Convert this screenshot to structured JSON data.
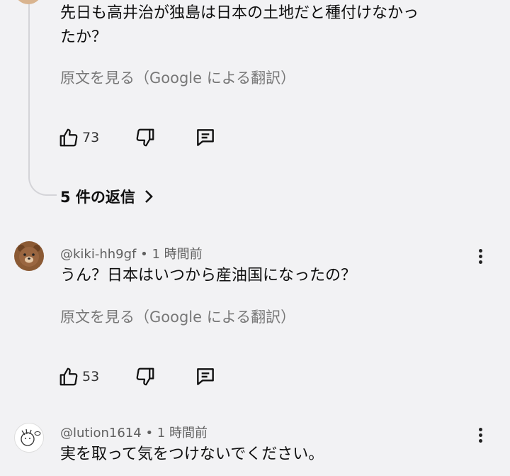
{
  "comments": [
    {
      "text_line1": "先日も高井治が独島は日本の土地だと種付けなかっ",
      "text_line2": "たか？",
      "translate_label": "原文を見る（Google による翻訳）",
      "likes": "73",
      "replies_label": "5 件の返信"
    },
    {
      "handle": "@kiki-hh9gf",
      "time": "1 時間前",
      "text": "うん？日本はいつから産油国になったの？",
      "translate_label": "原文を見る（Google による翻訳）",
      "likes": "53"
    },
    {
      "handle": "@lution1614",
      "time": "1 時間前",
      "text": "実を取って気をつけないでください。"
    }
  ],
  "meta_separator": "•",
  "icons": {
    "like": "thumb-up-icon",
    "dislike": "thumb-down-icon",
    "reply": "comment-reply-icon",
    "more": "more-vertical-icon",
    "chevron": "chevron-right-icon"
  }
}
